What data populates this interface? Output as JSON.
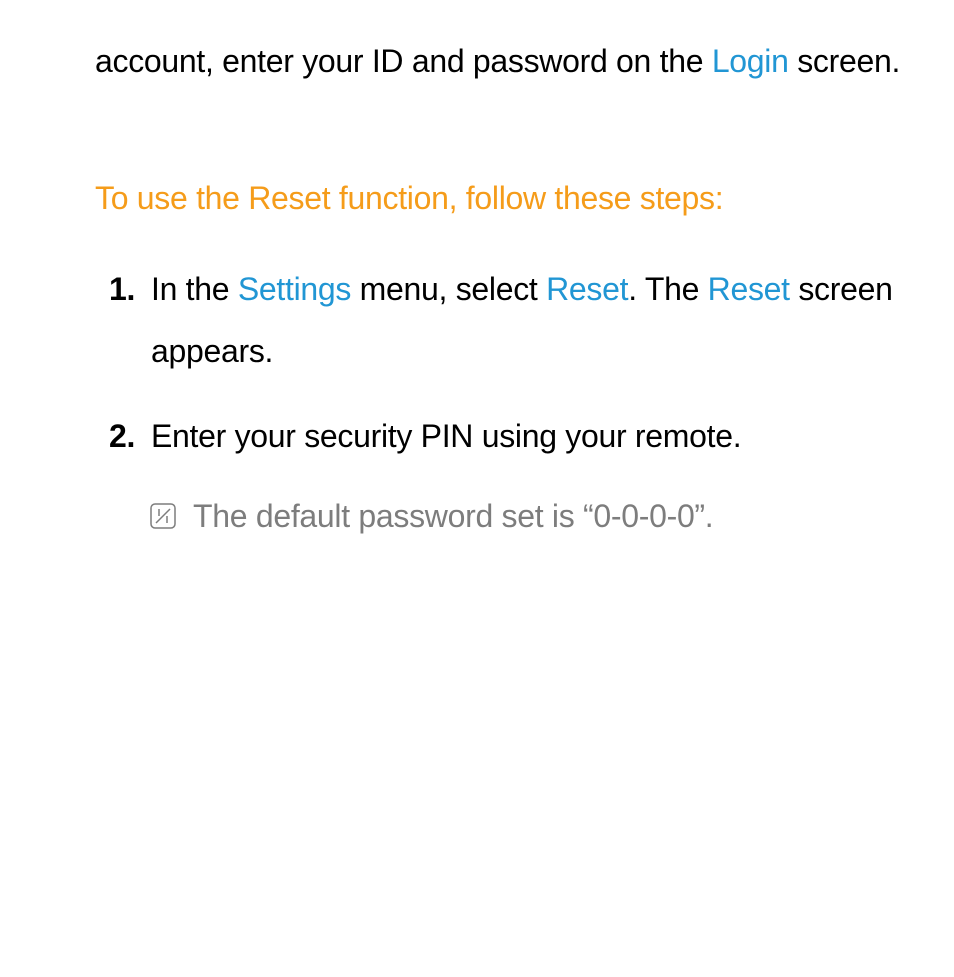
{
  "intro": {
    "prefix": "account, enter your ID and password on the ",
    "login_label": "Login",
    "suffix": " screen."
  },
  "heading_text": "To use the Reset function, follow these steps:",
  "steps": {
    "step1": {
      "prefix": "In the ",
      "settings_label": "Settings",
      "mid1": " menu, select ",
      "reset_label1": "Reset",
      "mid2": ". The ",
      "reset_label2": "Reset",
      "suffix": " screen appears."
    },
    "step2": {
      "text": "Enter your security PIN using your remote."
    }
  },
  "note": {
    "text": "The default password set is “0-0-0-0”."
  },
  "icons": {
    "note_icon": "note-icon"
  }
}
